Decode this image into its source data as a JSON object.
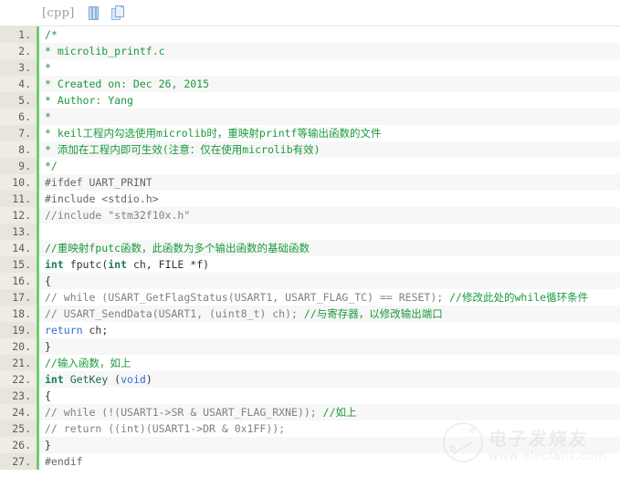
{
  "toolbar": {
    "language_label": "[cpp]",
    "view_plain_icon": "document-icon",
    "copy_icon": "copy-pages-icon"
  },
  "watermark": {
    "brand_cn": "电子发烧友",
    "url": "www.elecfans.com",
    "logo_icon": "circle-swoosh-logo-icon"
  },
  "code": {
    "language": "cpp",
    "lines": [
      {
        "n": "1.",
        "tokens": [
          {
            "c": "t-com",
            "t": "/*"
          }
        ]
      },
      {
        "n": "2.",
        "tokens": [
          {
            "c": "t-com",
            "t": " * microlib_printf.c"
          }
        ]
      },
      {
        "n": "3.",
        "tokens": [
          {
            "c": "t-com",
            "t": " *"
          }
        ]
      },
      {
        "n": "4.",
        "tokens": [
          {
            "c": "t-com",
            "t": " *  Created on: Dec 26, 2015"
          }
        ]
      },
      {
        "n": "5.",
        "tokens": [
          {
            "c": "t-com",
            "t": " *      Author: Yang"
          }
        ]
      },
      {
        "n": "6.",
        "tokens": [
          {
            "c": "t-com",
            "t": " *"
          }
        ]
      },
      {
        "n": "7.",
        "tokens": [
          {
            "c": "t-com",
            "t": " *    keil工程内勾选使用microlib时，重映射printf等输出函数的文件"
          }
        ]
      },
      {
        "n": "8.",
        "tokens": [
          {
            "c": "t-com",
            "t": " *    添加在工程内即可生效(注意：仅在使用microlib有效)"
          }
        ]
      },
      {
        "n": "9.",
        "tokens": [
          {
            "c": "t-com",
            "t": " */"
          }
        ]
      },
      {
        "n": "10.",
        "tokens": [
          {
            "c": "t-pre",
            "t": "#ifdef UART_PRINT"
          }
        ]
      },
      {
        "n": "11.",
        "tokens": [
          {
            "c": "t-pre",
            "t": "#include <stdio.h>"
          }
        ]
      },
      {
        "n": "12.",
        "tokens": [
          {
            "c": "t-comg",
            "t": "//include \"stm32f10x.h\""
          }
        ]
      },
      {
        "n": "13.",
        "tokens": [
          {
            "c": "t-pl",
            "t": ""
          }
        ]
      },
      {
        "n": "14.",
        "tokens": [
          {
            "c": "t-com",
            "t": "//重映射fputc函数，此函数为多个输出函数的基础函数"
          }
        ]
      },
      {
        "n": "15.",
        "tokens": [
          {
            "c": "t-kw",
            "t": "int"
          },
          {
            "c": "t-pl",
            "t": " fputc("
          },
          {
            "c": "t-kw",
            "t": "int"
          },
          {
            "c": "t-pl",
            "t": " ch, FILE *f)"
          }
        ]
      },
      {
        "n": "16.",
        "tokens": [
          {
            "c": "t-pl",
            "t": "{"
          }
        ]
      },
      {
        "n": "17.",
        "tokens": [
          {
            "c": "t-comg",
            "t": "//  while (USART_GetFlagStatus(USART1, USART_FLAG_TC) == RESET);"
          },
          {
            "c": "t-pl",
            "t": "    "
          },
          {
            "c": "t-com",
            "t": "//修改此处的while循环条件"
          }
        ]
      },
      {
        "n": "18.",
        "tokens": [
          {
            "c": "t-comg",
            "t": "//  USART_SendData(USART1, (uint8_t) ch);"
          },
          {
            "c": "t-pl",
            "t": "                      "
          },
          {
            "c": "t-com",
            "t": "//与寄存器，以修改输出端口"
          }
        ]
      },
      {
        "n": "19.",
        "tokens": [
          {
            "c": "t-kw2",
            "t": "    return"
          },
          {
            "c": "t-pl",
            "t": " ch;"
          }
        ]
      },
      {
        "n": "20.",
        "tokens": [
          {
            "c": "t-pl",
            "t": "}"
          }
        ]
      },
      {
        "n": "21.",
        "tokens": [
          {
            "c": "t-com",
            "t": "//输入函数，如上"
          }
        ]
      },
      {
        "n": "22.",
        "tokens": [
          {
            "c": "t-kw",
            "t": "int"
          },
          {
            "c": "t-fn",
            "t": " GetKey "
          },
          {
            "c": "t-pl",
            "t": "("
          },
          {
            "c": "t-kw2",
            "t": "void"
          },
          {
            "c": "t-pl",
            "t": ")"
          }
        ]
      },
      {
        "n": "23.",
        "tokens": [
          {
            "c": "t-pl",
            "t": "{"
          }
        ]
      },
      {
        "n": "24.",
        "tokens": [
          {
            "c": "t-comg",
            "t": "//  while (!(USART1->SR & USART_FLAG_RXNE));"
          },
          {
            "c": "t-pl",
            "t": "            "
          },
          {
            "c": "t-com",
            "t": "//如上"
          }
        ]
      },
      {
        "n": "25.",
        "tokens": [
          {
            "c": "t-comg",
            "t": "//  return ((int)(USART1->DR & 0x1FF));"
          }
        ]
      },
      {
        "n": "26.",
        "tokens": [
          {
            "c": "t-pl",
            "t": "}"
          }
        ]
      },
      {
        "n": "27.",
        "tokens": [
          {
            "c": "t-pre",
            "t": "#endif"
          }
        ]
      }
    ]
  }
}
